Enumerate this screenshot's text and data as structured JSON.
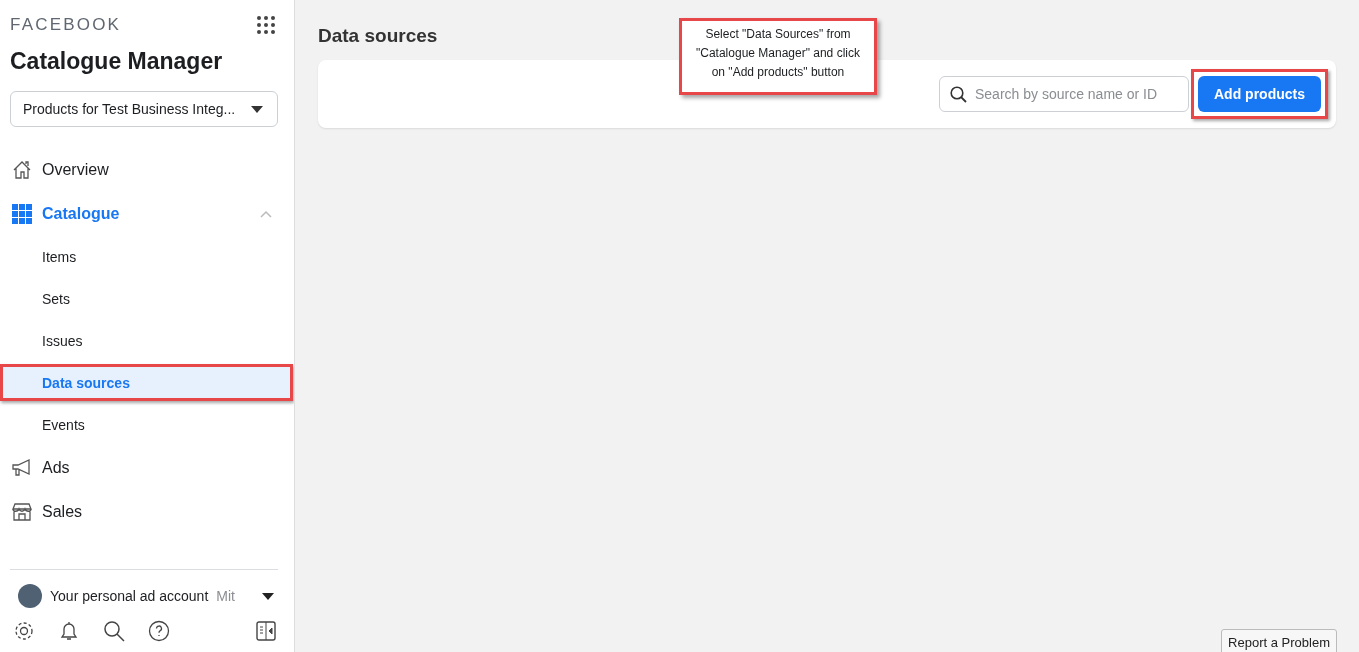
{
  "brand": "FACEBOOK",
  "app_title": "Catalogue Manager",
  "catalogue_selector": {
    "value": "Products for Test Business Integ..."
  },
  "nav": [
    {
      "label": "Overview",
      "kind": "home",
      "selected": false
    },
    {
      "label": "Catalogue",
      "kind": "grid",
      "selected": true,
      "expanded": true,
      "children": [
        {
          "label": "Items",
          "selected": false,
          "highlighted": false
        },
        {
          "label": "Sets",
          "selected": false,
          "highlighted": false
        },
        {
          "label": "Issues",
          "selected": false,
          "highlighted": false
        },
        {
          "label": "Data sources",
          "selected": true,
          "highlighted": true
        },
        {
          "label": "Events",
          "selected": false,
          "highlighted": false
        }
      ]
    },
    {
      "label": "Ads",
      "kind": "megaphone",
      "selected": false
    },
    {
      "label": "Sales",
      "kind": "store",
      "selected": false
    }
  ],
  "account": {
    "name": "Your personal ad account",
    "suffix": "Mit"
  },
  "page_title": "Data sources",
  "search": {
    "placeholder": "Search by source name or ID"
  },
  "add_button": {
    "label": "Add products",
    "highlighted": true
  },
  "callout": "Select \"Data Sources\" from \"Catalogue Manager\"  and click on \"Add products\" button",
  "report_button": "Report a Problem"
}
